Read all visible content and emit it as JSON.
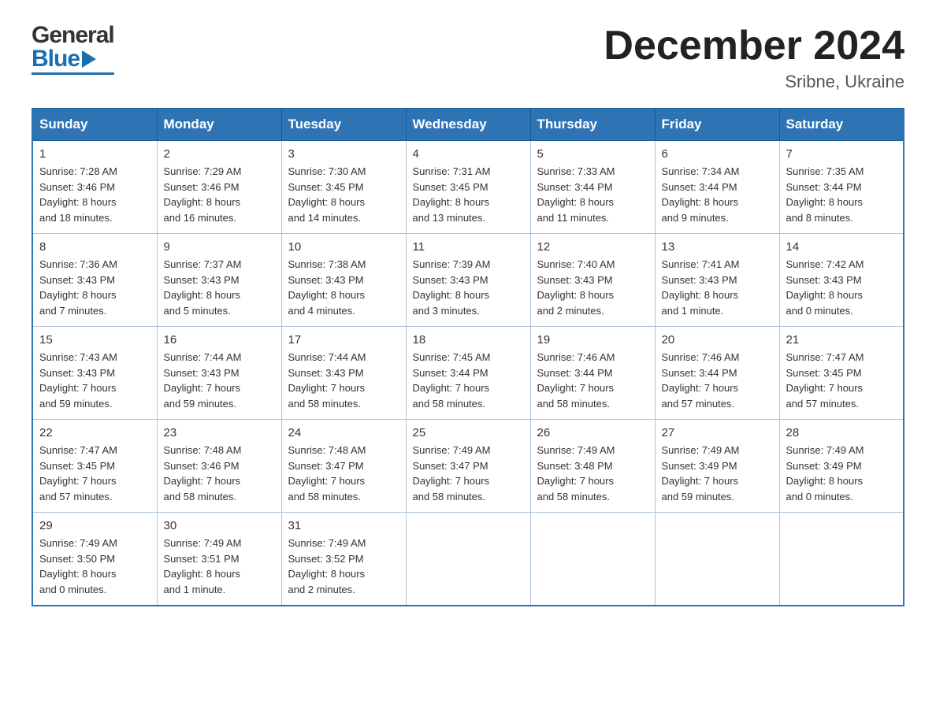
{
  "header": {
    "month_title": "December 2024",
    "location": "Sribne, Ukraine",
    "logo_top": "General",
    "logo_bottom": "Blue"
  },
  "days_of_week": [
    "Sunday",
    "Monday",
    "Tuesday",
    "Wednesday",
    "Thursday",
    "Friday",
    "Saturday"
  ],
  "weeks": [
    [
      {
        "day": "1",
        "sunrise": "7:28 AM",
        "sunset": "3:46 PM",
        "daylight": "8 hours and 18 minutes."
      },
      {
        "day": "2",
        "sunrise": "7:29 AM",
        "sunset": "3:46 PM",
        "daylight": "8 hours and 16 minutes."
      },
      {
        "day": "3",
        "sunrise": "7:30 AM",
        "sunset": "3:45 PM",
        "daylight": "8 hours and 14 minutes."
      },
      {
        "day": "4",
        "sunrise": "7:31 AM",
        "sunset": "3:45 PM",
        "daylight": "8 hours and 13 minutes."
      },
      {
        "day": "5",
        "sunrise": "7:33 AM",
        "sunset": "3:44 PM",
        "daylight": "8 hours and 11 minutes."
      },
      {
        "day": "6",
        "sunrise": "7:34 AM",
        "sunset": "3:44 PM",
        "daylight": "8 hours and 9 minutes."
      },
      {
        "day": "7",
        "sunrise": "7:35 AM",
        "sunset": "3:44 PM",
        "daylight": "8 hours and 8 minutes."
      }
    ],
    [
      {
        "day": "8",
        "sunrise": "7:36 AM",
        "sunset": "3:43 PM",
        "daylight": "8 hours and 7 minutes."
      },
      {
        "day": "9",
        "sunrise": "7:37 AM",
        "sunset": "3:43 PM",
        "daylight": "8 hours and 5 minutes."
      },
      {
        "day": "10",
        "sunrise": "7:38 AM",
        "sunset": "3:43 PM",
        "daylight": "8 hours and 4 minutes."
      },
      {
        "day": "11",
        "sunrise": "7:39 AM",
        "sunset": "3:43 PM",
        "daylight": "8 hours and 3 minutes."
      },
      {
        "day": "12",
        "sunrise": "7:40 AM",
        "sunset": "3:43 PM",
        "daylight": "8 hours and 2 minutes."
      },
      {
        "day": "13",
        "sunrise": "7:41 AM",
        "sunset": "3:43 PM",
        "daylight": "8 hours and 1 minute."
      },
      {
        "day": "14",
        "sunrise": "7:42 AM",
        "sunset": "3:43 PM",
        "daylight": "8 hours and 0 minutes."
      }
    ],
    [
      {
        "day": "15",
        "sunrise": "7:43 AM",
        "sunset": "3:43 PM",
        "daylight": "7 hours and 59 minutes."
      },
      {
        "day": "16",
        "sunrise": "7:44 AM",
        "sunset": "3:43 PM",
        "daylight": "7 hours and 59 minutes."
      },
      {
        "day": "17",
        "sunrise": "7:44 AM",
        "sunset": "3:43 PM",
        "daylight": "7 hours and 58 minutes."
      },
      {
        "day": "18",
        "sunrise": "7:45 AM",
        "sunset": "3:44 PM",
        "daylight": "7 hours and 58 minutes."
      },
      {
        "day": "19",
        "sunrise": "7:46 AM",
        "sunset": "3:44 PM",
        "daylight": "7 hours and 58 minutes."
      },
      {
        "day": "20",
        "sunrise": "7:46 AM",
        "sunset": "3:44 PM",
        "daylight": "7 hours and 57 minutes."
      },
      {
        "day": "21",
        "sunrise": "7:47 AM",
        "sunset": "3:45 PM",
        "daylight": "7 hours and 57 minutes."
      }
    ],
    [
      {
        "day": "22",
        "sunrise": "7:47 AM",
        "sunset": "3:45 PM",
        "daylight": "7 hours and 57 minutes."
      },
      {
        "day": "23",
        "sunrise": "7:48 AM",
        "sunset": "3:46 PM",
        "daylight": "7 hours and 58 minutes."
      },
      {
        "day": "24",
        "sunrise": "7:48 AM",
        "sunset": "3:47 PM",
        "daylight": "7 hours and 58 minutes."
      },
      {
        "day": "25",
        "sunrise": "7:49 AM",
        "sunset": "3:47 PM",
        "daylight": "7 hours and 58 minutes."
      },
      {
        "day": "26",
        "sunrise": "7:49 AM",
        "sunset": "3:48 PM",
        "daylight": "7 hours and 58 minutes."
      },
      {
        "day": "27",
        "sunrise": "7:49 AM",
        "sunset": "3:49 PM",
        "daylight": "7 hours and 59 minutes."
      },
      {
        "day": "28",
        "sunrise": "7:49 AM",
        "sunset": "3:49 PM",
        "daylight": "8 hours and 0 minutes."
      }
    ],
    [
      {
        "day": "29",
        "sunrise": "7:49 AM",
        "sunset": "3:50 PM",
        "daylight": "8 hours and 0 minutes."
      },
      {
        "day": "30",
        "sunrise": "7:49 AM",
        "sunset": "3:51 PM",
        "daylight": "8 hours and 1 minute."
      },
      {
        "day": "31",
        "sunrise": "7:49 AM",
        "sunset": "3:52 PM",
        "daylight": "8 hours and 2 minutes."
      },
      null,
      null,
      null,
      null
    ]
  ],
  "labels": {
    "sunrise": "Sunrise:",
    "sunset": "Sunset:",
    "daylight": "Daylight:"
  }
}
